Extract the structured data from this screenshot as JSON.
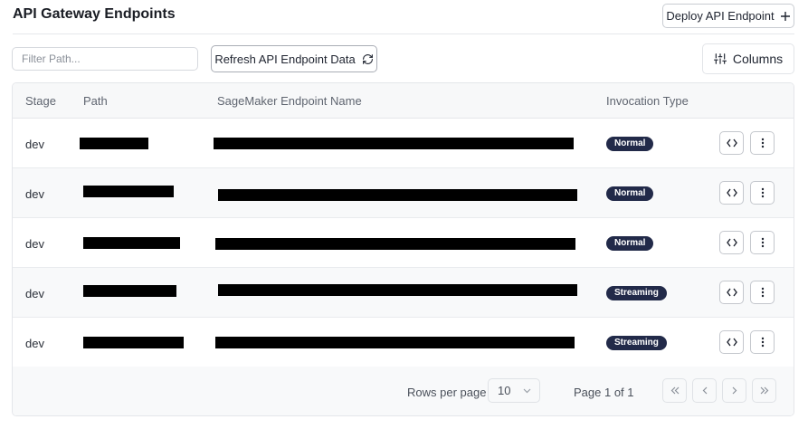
{
  "header": {
    "title": "API Gateway Endpoints",
    "deploy_label": "Deploy API Endpoint"
  },
  "toolbar": {
    "filter_placeholder": "Filter Path...",
    "refresh_label": "Refresh API Endpoint Data",
    "columns_label": "Columns"
  },
  "table": {
    "columns": [
      "Stage",
      "Path",
      "SageMaker Endpoint Name",
      "Invocation Type"
    ],
    "rows": [
      {
        "stage": "dev",
        "path": "[redacted]",
        "endpoint_name": "[redacted]",
        "invocation_type": "Normal"
      },
      {
        "stage": "dev",
        "path": "[redacted]",
        "endpoint_name": "[redacted]",
        "invocation_type": "Normal"
      },
      {
        "stage": "dev",
        "path": "[redacted]",
        "endpoint_name": "[redacted]",
        "invocation_type": "Normal"
      },
      {
        "stage": "dev",
        "path": "[redacted]",
        "endpoint_name": "[redacted]",
        "invocation_type": "Streaming"
      },
      {
        "stage": "dev",
        "path": "[redacted]",
        "endpoint_name": "[redacted]",
        "invocation_type": "Streaming"
      }
    ]
  },
  "pagination": {
    "rows_per_page_label": "Rows per page",
    "rows_per_page_value": "10",
    "page_info": "Page 1 of 1"
  },
  "colors": {
    "badge_bg": "#222a49",
    "badge_text": "#ffffff"
  },
  "icons": {
    "deploy": "plus-icon",
    "refresh": "refresh-icon",
    "columns": "sliders-icon",
    "row_code": "code-icon",
    "row_menu": "more-vertical-icon",
    "first_page": "chevrons-left-icon",
    "prev_page": "chevron-left-icon",
    "next_page": "chevron-right-icon",
    "last_page": "chevrons-right-icon"
  }
}
